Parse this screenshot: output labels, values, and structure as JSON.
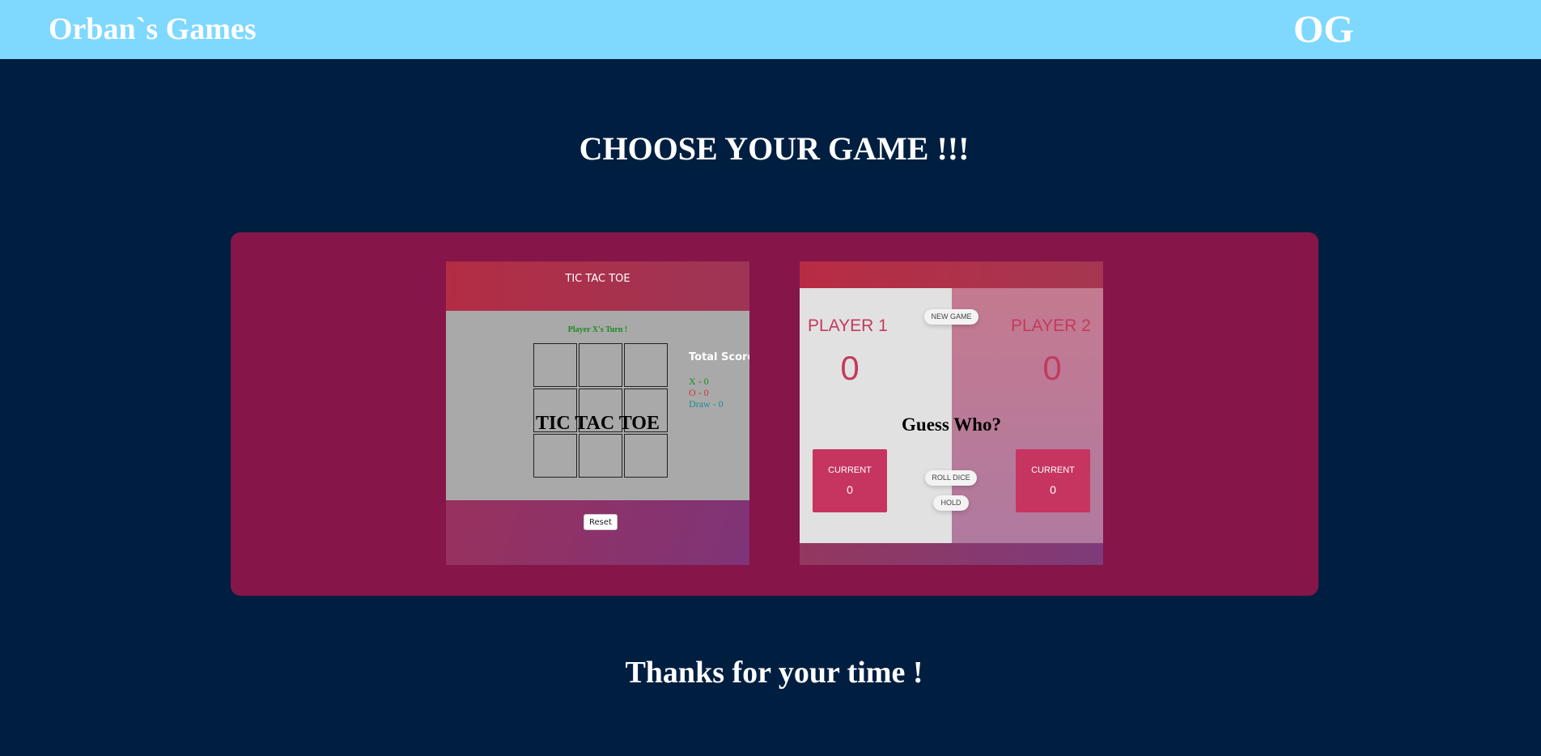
{
  "header": {
    "brand": "Orban`s Games",
    "logo": "OG"
  },
  "main": {
    "heading": "CHOOSE YOUR GAME !!!",
    "games": [
      {
        "title": "TIC TAC TOE",
        "preview": {
          "header_title": "TIC TAC TOE",
          "turn_text": "Player X's Turn !",
          "score_title": "Total Score",
          "score_x": "X - 0",
          "score_o": "O - 0",
          "score_draw": "Draw - 0",
          "reset_label": "Reset"
        }
      },
      {
        "title": "Guess Who?",
        "preview": {
          "player1": "PLAYER 1",
          "player2": "PLAYER 2",
          "score1": "0",
          "score2": "0",
          "new_game": "NEW GAME",
          "roll_dice": "ROLL DICE",
          "hold": "HOLD",
          "current_label": "CURRENT",
          "current1": "0",
          "current2": "0"
        }
      }
    ]
  },
  "footer": {
    "thanks": "Thanks for your time !"
  },
  "colors": {
    "navbar": "#7fd8fe",
    "page_bg": "#001f40",
    "panel": "#861549",
    "accent": "#c33a5e"
  }
}
